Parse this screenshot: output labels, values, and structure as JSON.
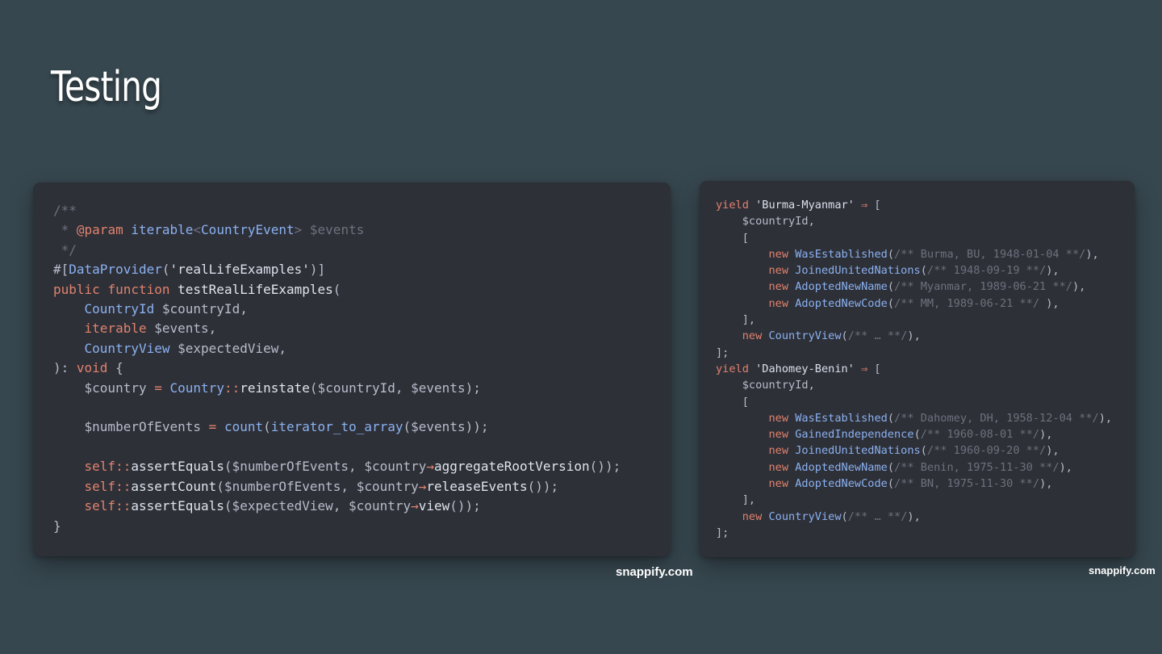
{
  "slide": {
    "title": "Testing"
  },
  "watermarks": {
    "left": "snappify.com",
    "right": "snappify.com"
  },
  "colors": {
    "background": "#37474f",
    "card": "#2e3038",
    "keyword": "#e0826d",
    "type": "#8ab1f0",
    "comment": "#6d717c",
    "text": "#b6bcc9"
  },
  "left_code": [
    [
      [
        "c",
        "/**"
      ]
    ],
    [
      [
        "c",
        " * "
      ],
      [
        "k",
        "@param"
      ],
      [
        "c",
        " "
      ],
      [
        "t",
        "iterable"
      ],
      [
        "c",
        "<"
      ],
      [
        "t",
        "CountryEvent"
      ],
      [
        "c",
        "> $events"
      ]
    ],
    [
      [
        "c",
        " */"
      ]
    ],
    [
      [
        "p",
        "#["
      ],
      [
        "t",
        "DataProvider"
      ],
      [
        "p",
        "("
      ],
      [
        "s",
        "'realLifeExamples'"
      ],
      [
        "p",
        ")]"
      ]
    ],
    [
      [
        "k",
        "public"
      ],
      [
        "p",
        " "
      ],
      [
        "k",
        "function"
      ],
      [
        "p",
        " "
      ],
      [
        "f",
        "testRealLifeExamples"
      ],
      [
        "p",
        "("
      ]
    ],
    [
      [
        "p",
        "    "
      ],
      [
        "t",
        "CountryId"
      ],
      [
        "v",
        " $countryId,"
      ]
    ],
    [
      [
        "p",
        "    "
      ],
      [
        "k",
        "iterable"
      ],
      [
        "v",
        " $events,"
      ]
    ],
    [
      [
        "p",
        "    "
      ],
      [
        "t",
        "CountryView"
      ],
      [
        "v",
        " $expectedView,"
      ]
    ],
    [
      [
        "p",
        "): "
      ],
      [
        "k",
        "void"
      ],
      [
        "p",
        " {"
      ]
    ],
    [
      [
        "v",
        "    $country "
      ],
      [
        "o",
        "="
      ],
      [
        "p",
        " "
      ],
      [
        "t",
        "Country"
      ],
      [
        "o",
        "::"
      ],
      [
        "f",
        "reinstate"
      ],
      [
        "v",
        "($countryId, $events);"
      ]
    ],
    [],
    [
      [
        "v",
        "    $numberOfEvents "
      ],
      [
        "o",
        "="
      ],
      [
        "p",
        " "
      ],
      [
        "t",
        "count"
      ],
      [
        "p",
        "("
      ],
      [
        "t",
        "iterator_to_array"
      ],
      [
        "v",
        "($events));"
      ]
    ],
    [],
    [
      [
        "p",
        "    "
      ],
      [
        "k",
        "self"
      ],
      [
        "o",
        "::"
      ],
      [
        "f",
        "assertEquals"
      ],
      [
        "v",
        "($numberOfEvents, $country"
      ],
      [
        "o",
        "→"
      ],
      [
        "f",
        "aggregateRootVersion"
      ],
      [
        "p",
        "());"
      ]
    ],
    [
      [
        "p",
        "    "
      ],
      [
        "k",
        "self"
      ],
      [
        "o",
        "::"
      ],
      [
        "f",
        "assertCount"
      ],
      [
        "v",
        "($numberOfEvents, $country"
      ],
      [
        "o",
        "→"
      ],
      [
        "f",
        "releaseEvents"
      ],
      [
        "p",
        "());"
      ]
    ],
    [
      [
        "p",
        "    "
      ],
      [
        "k",
        "self"
      ],
      [
        "o",
        "::"
      ],
      [
        "f",
        "assertEquals"
      ],
      [
        "v",
        "($expectedView, $country"
      ],
      [
        "o",
        "→"
      ],
      [
        "f",
        "view"
      ],
      [
        "p",
        "());"
      ]
    ],
    [
      [
        "p",
        "}"
      ]
    ]
  ],
  "right_code": [
    [
      [
        "k",
        "yield"
      ],
      [
        "p",
        " "
      ],
      [
        "s",
        "'Burma-Myanmar'"
      ],
      [
        "p",
        " "
      ],
      [
        "o",
        "⇒"
      ],
      [
        "p",
        " ["
      ]
    ],
    [
      [
        "v",
        "    $countryId,"
      ]
    ],
    [
      [
        "p",
        "    ["
      ]
    ],
    [
      [
        "p",
        "        "
      ],
      [
        "k",
        "new"
      ],
      [
        "p",
        " "
      ],
      [
        "t",
        "WasEstablished"
      ],
      [
        "p",
        "("
      ],
      [
        "c",
        "/** Burma, BU, 1948-01-04 **/"
      ],
      [
        "p",
        "),"
      ]
    ],
    [
      [
        "p",
        "        "
      ],
      [
        "k",
        "new"
      ],
      [
        "p",
        " "
      ],
      [
        "t",
        "JoinedUnitedNations"
      ],
      [
        "p",
        "("
      ],
      [
        "c",
        "/** 1948-09-19 **/"
      ],
      [
        "p",
        "),"
      ]
    ],
    [
      [
        "p",
        "        "
      ],
      [
        "k",
        "new"
      ],
      [
        "p",
        " "
      ],
      [
        "t",
        "AdoptedNewName"
      ],
      [
        "p",
        "("
      ],
      [
        "c",
        "/** Myanmar, 1989-06-21 **/"
      ],
      [
        "p",
        "),"
      ]
    ],
    [
      [
        "p",
        "        "
      ],
      [
        "k",
        "new"
      ],
      [
        "p",
        " "
      ],
      [
        "t",
        "AdoptedNewCode"
      ],
      [
        "p",
        "("
      ],
      [
        "c",
        "/** MM, 1989-06-21 **/"
      ],
      [
        "p",
        " ),"
      ]
    ],
    [
      [
        "p",
        "    ],"
      ]
    ],
    [
      [
        "p",
        "    "
      ],
      [
        "k",
        "new"
      ],
      [
        "p",
        " "
      ],
      [
        "t",
        "CountryView"
      ],
      [
        "p",
        "("
      ],
      [
        "c",
        "/** … **/"
      ],
      [
        "p",
        "),"
      ]
    ],
    [
      [
        "p",
        "];"
      ]
    ],
    [
      [
        "k",
        "yield"
      ],
      [
        "p",
        " "
      ],
      [
        "s",
        "'Dahomey-Benin'"
      ],
      [
        "p",
        " "
      ],
      [
        "o",
        "⇒"
      ],
      [
        "p",
        " ["
      ]
    ],
    [
      [
        "v",
        "    $countryId,"
      ]
    ],
    [
      [
        "p",
        "    ["
      ]
    ],
    [
      [
        "p",
        "        "
      ],
      [
        "k",
        "new"
      ],
      [
        "p",
        " "
      ],
      [
        "t",
        "WasEstablished"
      ],
      [
        "p",
        "("
      ],
      [
        "c",
        "/** Dahomey, DH, 1958-12-04 **/"
      ],
      [
        "p",
        "),"
      ]
    ],
    [
      [
        "p",
        "        "
      ],
      [
        "k",
        "new"
      ],
      [
        "p",
        " "
      ],
      [
        "t",
        "GainedIndependence"
      ],
      [
        "p",
        "("
      ],
      [
        "c",
        "/** 1960-08-01 **/"
      ],
      [
        "p",
        "),"
      ]
    ],
    [
      [
        "p",
        "        "
      ],
      [
        "k",
        "new"
      ],
      [
        "p",
        " "
      ],
      [
        "t",
        "JoinedUnitedNations"
      ],
      [
        "p",
        "("
      ],
      [
        "c",
        "/** 1960-09-20 **/"
      ],
      [
        "p",
        "),"
      ]
    ],
    [
      [
        "p",
        "        "
      ],
      [
        "k",
        "new"
      ],
      [
        "p",
        " "
      ],
      [
        "t",
        "AdoptedNewName"
      ],
      [
        "p",
        "("
      ],
      [
        "c",
        "/** Benin, 1975-11-30 **/"
      ],
      [
        "p",
        "),"
      ]
    ],
    [
      [
        "p",
        "        "
      ],
      [
        "k",
        "new"
      ],
      [
        "p",
        " "
      ],
      [
        "t",
        "AdoptedNewCode"
      ],
      [
        "p",
        "("
      ],
      [
        "c",
        "/** BN, 1975-11-30 **/"
      ],
      [
        "p",
        "),"
      ]
    ],
    [
      [
        "p",
        "    ],"
      ]
    ],
    [
      [
        "p",
        "    "
      ],
      [
        "k",
        "new"
      ],
      [
        "p",
        " "
      ],
      [
        "t",
        "CountryView"
      ],
      [
        "p",
        "("
      ],
      [
        "c",
        "/** … **/"
      ],
      [
        "p",
        "),"
      ]
    ],
    [
      [
        "p",
        "];"
      ]
    ]
  ]
}
